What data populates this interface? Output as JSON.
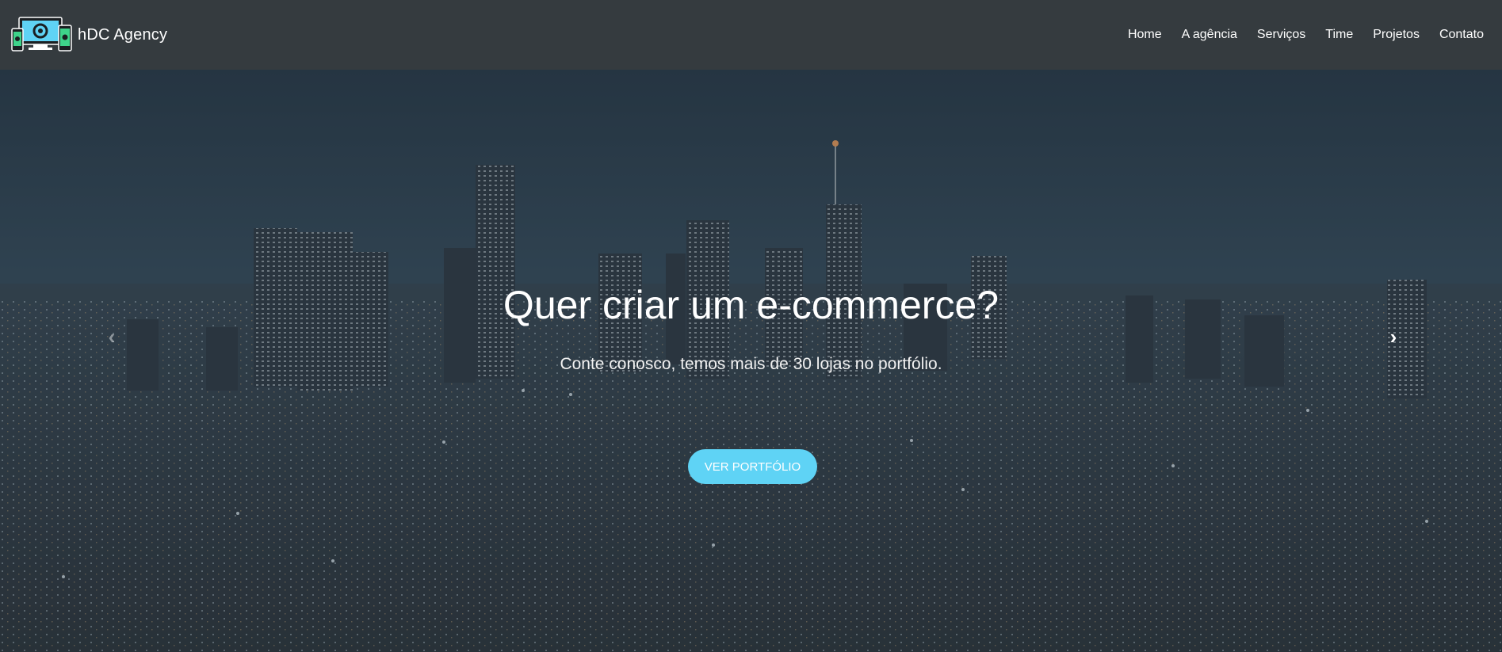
{
  "brand": {
    "name": "hDC Agency",
    "logo_icon": "devices-logo-icon"
  },
  "nav": {
    "items": [
      {
        "label": "Home"
      },
      {
        "label": "A agência"
      },
      {
        "label": "Serviços"
      },
      {
        "label": "Time"
      },
      {
        "label": "Projetos"
      },
      {
        "label": "Contato"
      }
    ]
  },
  "hero": {
    "title": "Quer criar um e-commerce?",
    "subtitle": "Conte conosco, temos mais de 30 lojas no portfólio.",
    "cta_label": "VER PORTFÓLIO",
    "prev_icon": "chevron-left-icon",
    "next_icon": "chevron-right-icon"
  },
  "colors": {
    "navbar_bg": "#353b3f",
    "accent": "#5fd3f5"
  }
}
